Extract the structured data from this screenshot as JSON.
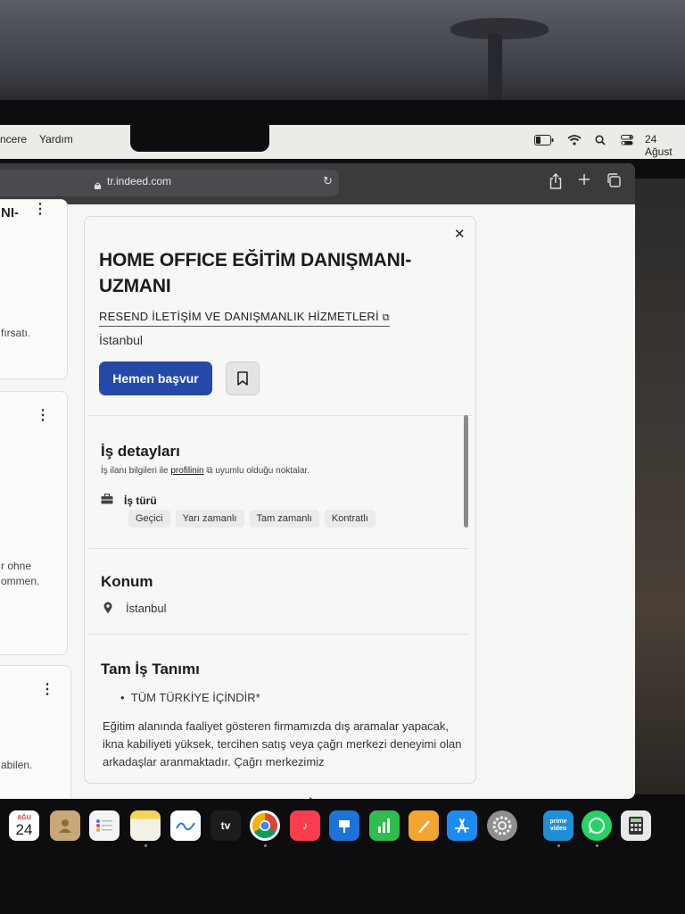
{
  "menubar": {
    "items": [
      "ncere",
      "Yardım"
    ],
    "date": "24 Ağust"
  },
  "browser": {
    "url": "tr.indeed.com"
  },
  "left_cards": {
    "card1": {
      "title_fragment": "NI-",
      "text": "fırsatı."
    },
    "card2": {
      "line1": "r ohne",
      "line2": "ommen."
    },
    "card3": {
      "text": "abilen."
    }
  },
  "job": {
    "title": "HOME OFFICE EĞİTİM DANIŞMANI-UZMANI",
    "company": "RESEND İLETİŞİM VE DANIŞMANLIK HİZMETLERİ",
    "location": "İstanbul",
    "apply_label": "Hemen başvur",
    "details": {
      "heading": "İş detayları",
      "sub_prefix": "İş ilanı bilgileri ile",
      "sub_link": "profilinin",
      "sub_suffix": "uyumlu olduğu noktalar.",
      "type_label": "İş türü",
      "tags": [
        "Geçici",
        "Yarı zamanlı",
        "Tam zamanlı",
        "Kontratlı"
      ]
    },
    "location_section": {
      "heading": "Konum",
      "value": "İstanbul"
    },
    "description": {
      "heading": "Tam İş Tanımı",
      "bullet": "TÜM TÜRKİYE İÇİNDİR*",
      "text": "Eğitim alanında faaliyet gösteren firmamızda dış aramalar yapacak, ikna kabiliyeti yüksek, tercihen satış veya çağrı merkezi deneyimi olan arkadaşlar aranmaktadır. Çağrı merkezimiz"
    }
  },
  "dock": {
    "calendar_month": "AĞU",
    "calendar_day": "24",
    "appletv": "tv",
    "prime": "prime video"
  },
  "colors": {
    "apply_blue": "#2449a8",
    "toolbar": "#3a3b3d"
  }
}
